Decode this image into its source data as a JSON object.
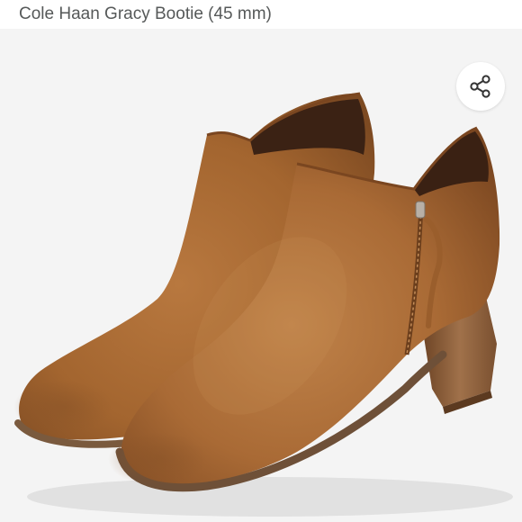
{
  "product": {
    "title": "Cole Haan Gracy Bootie (45 mm)"
  },
  "image": {
    "subject": "boot-pair-image"
  },
  "share": {
    "icon": "share-icon"
  },
  "colors": {
    "title_text": "#565959",
    "image_background": "#f4f4f4",
    "suede": "#a86a35",
    "heel": "#8a5a36"
  }
}
